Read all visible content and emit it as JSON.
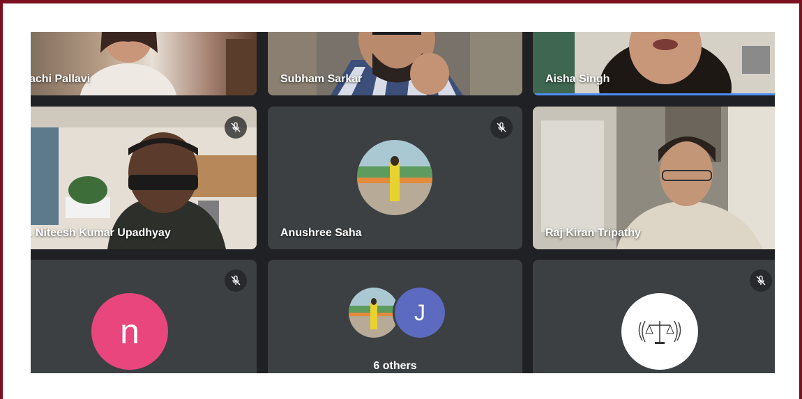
{
  "participants": [
    {
      "name": "achi Pallavi",
      "muted": false
    },
    {
      "name": "Subham Sarkar",
      "muted": false
    },
    {
      "name": "Aisha Singh",
      "muted": false,
      "speaking": true
    },
    {
      "name": ". Niteesh Kumar Upadhyay",
      "muted": true
    },
    {
      "name": "Anushree Saha",
      "muted": true
    },
    {
      "name": "Raj Kiran Tripathy",
      "muted": false
    },
    {
      "avatar_letter": "n",
      "muted": true
    },
    {
      "group_avatar_letter": "J",
      "others_label": "6 others"
    },
    {
      "muted": true
    }
  ],
  "icons": {
    "mute": "mic-off-icon"
  },
  "colors": {
    "frame": "#7a1020",
    "stage_bg": "#202124",
    "tile_bg": "#3c4043",
    "speaking_border": "#4e8df5",
    "avatar_n": "#e8467c",
    "avatar_j": "#5c6bc0"
  }
}
